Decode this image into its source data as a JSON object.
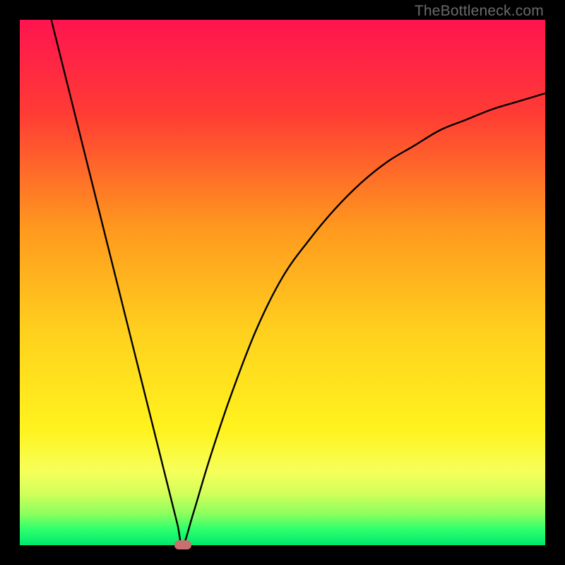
{
  "watermark": "TheBottleneck.com",
  "chart_data": {
    "type": "line",
    "title": "",
    "xlabel": "",
    "ylabel": "",
    "xlim": [
      0,
      100
    ],
    "ylim": [
      0,
      100
    ],
    "grid": false,
    "legend": null,
    "description": "V-shaped bottleneck curve over a vertical red-to-green heat gradient. The curve drops from top-left, reaches zero near x≈31, then rises with diminishing slope toward the right edge.",
    "series": [
      {
        "name": "bottleneck-curve",
        "x": [
          6,
          10,
          15,
          20,
          25,
          28,
          30,
          31,
          33,
          36,
          40,
          45,
          50,
          55,
          60,
          65,
          70,
          75,
          80,
          85,
          90,
          95,
          100
        ],
        "y": [
          100,
          84,
          64,
          44,
          24,
          12,
          4,
          0,
          6,
          16,
          28,
          41,
          51,
          58,
          64,
          69,
          73,
          76,
          79,
          81,
          83,
          84.5,
          86
        ]
      }
    ],
    "marker": {
      "x": 31,
      "y": 0,
      "color": "#c9706e"
    },
    "gradient_stops": [
      {
        "pct": 0,
        "color": "#ff1450"
      },
      {
        "pct": 18,
        "color": "#ff3c34"
      },
      {
        "pct": 40,
        "color": "#ff9a1e"
      },
      {
        "pct": 60,
        "color": "#ffd21e"
      },
      {
        "pct": 78,
        "color": "#fff31e"
      },
      {
        "pct": 86,
        "color": "#f6ff5a"
      },
      {
        "pct": 90,
        "color": "#d4ff5a"
      },
      {
        "pct": 94,
        "color": "#8cff5e"
      },
      {
        "pct": 97,
        "color": "#2dff6e"
      },
      {
        "pct": 100,
        "color": "#00e86b"
      }
    ]
  }
}
